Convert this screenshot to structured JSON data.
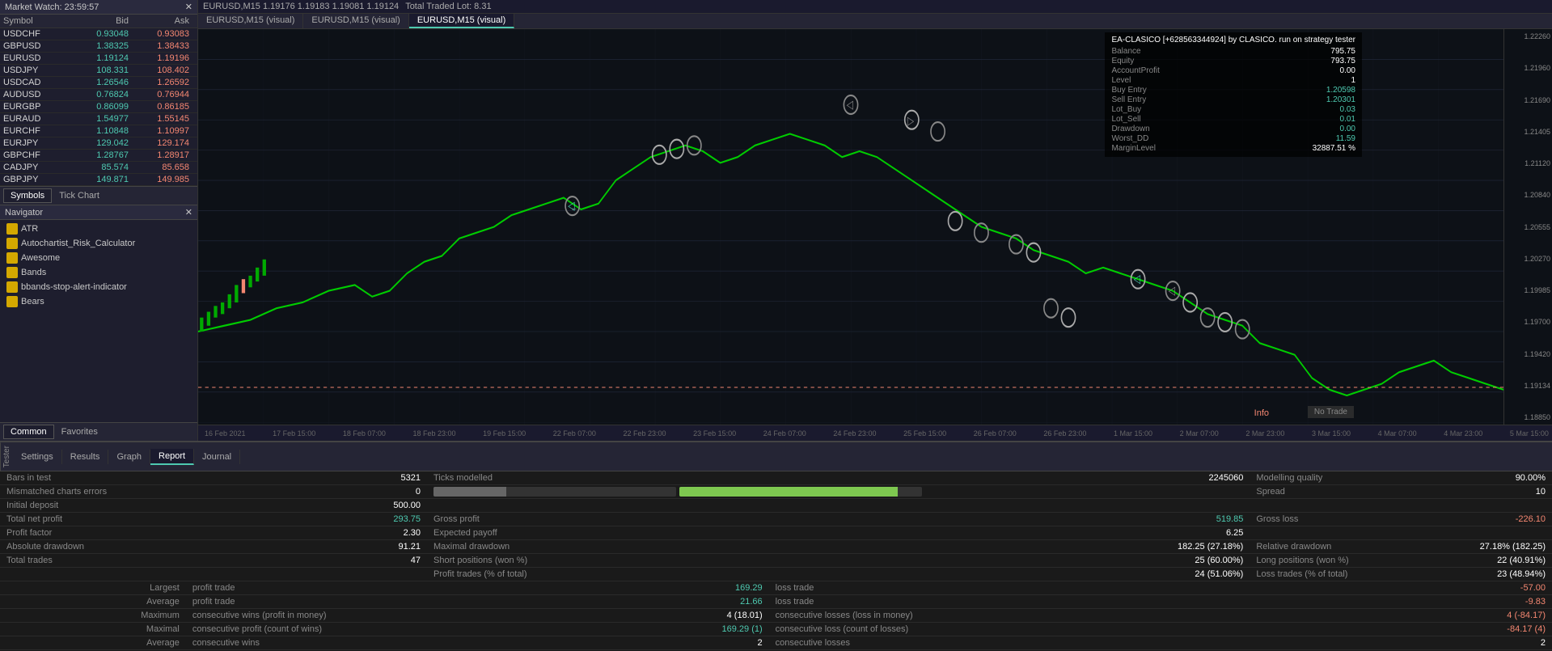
{
  "market_watch": {
    "title": "Market Watch: 23:59:57",
    "columns": [
      "Symbol",
      "Bid",
      "Ask"
    ],
    "rows": [
      {
        "symbol": "USDCHF",
        "bid": "0.93048",
        "ask": "0.93083"
      },
      {
        "symbol": "GBPUSD",
        "bid": "1.38325",
        "ask": "1.38433"
      },
      {
        "symbol": "EURUSD",
        "bid": "1.19124",
        "ask": "1.19196"
      },
      {
        "symbol": "USDJPY",
        "bid": "108.331",
        "ask": "108.402"
      },
      {
        "symbol": "USDCAD",
        "bid": "1.26546",
        "ask": "1.26592"
      },
      {
        "symbol": "AUDUSD",
        "bid": "0.76824",
        "ask": "0.76944"
      },
      {
        "symbol": "EURGBP",
        "bid": "0.86099",
        "ask": "0.86185"
      },
      {
        "symbol": "EURAUD",
        "bid": "1.54977",
        "ask": "1.55145"
      },
      {
        "symbol": "EURCHF",
        "bid": "1.10848",
        "ask": "1.10997"
      },
      {
        "symbol": "EURJPY",
        "bid": "129.042",
        "ask": "129.174"
      },
      {
        "symbol": "GBPCHF",
        "bid": "1.28767",
        "ask": "1.28917"
      },
      {
        "symbol": "CADJPY",
        "bid": "85.574",
        "ask": "85.658"
      },
      {
        "symbol": "GBPJPY",
        "bid": "149.871",
        "ask": "149.985"
      }
    ],
    "tabs": [
      "Symbols",
      "Tick Chart"
    ]
  },
  "navigator": {
    "title": "Navigator",
    "items": [
      "ATR",
      "Autochartist_Risk_Calculator",
      "Awesome",
      "Bands",
      "bbands-stop-alert-indicator",
      "Bears"
    ],
    "tabs": [
      "Common",
      "Favorites"
    ]
  },
  "chart": {
    "header_text": "EURUSD,M15 1.19176 1.19183 1.19081 1.19124",
    "traded_lot": "Total Traded Lot: 8.31",
    "tabs": [
      "EURUSD,M15 (visual)",
      "EURUSD,M15 (visual)",
      "EURUSD,M15 (visual)"
    ],
    "active_tab": 2,
    "time_labels": [
      "16 Feb 2021",
      "17 Feb 15:00",
      "18 Feb 07:00",
      "18 Feb 23:00",
      "19 Feb 15:00",
      "22 Feb 07:00",
      "22 Feb 23:00",
      "23 Feb 15:00",
      "24 Feb 07:00",
      "24 Feb 23:00",
      "25 Feb 15:00",
      "26 Feb 07:00",
      "26 Feb 23:00",
      "1 Mar 15:00",
      "2 Mar 07:00",
      "2 Mar 23:00",
      "3 Mar 15:00",
      "4 Mar 07:00",
      "4 Mar 23:00",
      "5 Mar 15:00"
    ],
    "price_levels": [
      "1.22260",
      "1.21960",
      "1.21690",
      "1.21405",
      "1.21120",
      "1.20840",
      "1.20555",
      "1.20270",
      "1.19985",
      "1.19700",
      "1.19420",
      "1.19134",
      "1.18850"
    ],
    "ea_info": {
      "title": "EA-CLASICO [+628563344924] by CLASICO. run on strategy tester",
      "balance_label": "Balance",
      "balance_value": "795.75",
      "equity_label": "Equity",
      "equity_value": "793.75",
      "account_profit_label": "AccountProfit",
      "account_profit_value": "0.00",
      "level_label": "Level",
      "level_value": "1",
      "buy_entry_label": "Buy Entry",
      "buy_entry_value": "1.20598",
      "sell_entry_label": "Sell Entry",
      "sell_entry_value": "1.20301",
      "lot_buy_label": "Lot_Buy",
      "lot_buy_value": "0.03",
      "lot_sell_label": "Lot_Sell",
      "lot_sell_value": "0.01",
      "drawdown_label": "Drawdown",
      "drawdown_value": "0.00",
      "worst_dd_label": "Worst_DD",
      "worst_dd_value": "11.59",
      "margin_level_label": "MarginLevel",
      "margin_level_value": "32887.51 %"
    },
    "no_trade": "No Trade",
    "info_label": "Info"
  },
  "report": {
    "tabs": [
      "Settings",
      "Results",
      "Graph",
      "Report",
      "Journal"
    ],
    "active_tab": "Report",
    "tester_label": "Tester",
    "rows": {
      "bars_in_test_label": "Bars in test",
      "bars_in_test_value": "5321",
      "ticks_modelled_label": "Ticks modelled",
      "ticks_modelled_value": "2245060",
      "modelling_quality_label": "Modelling quality",
      "modelling_quality_value": "90.00%",
      "mismatched_label": "Mismatched charts errors",
      "mismatched_value": "0",
      "spread_label": "Spread",
      "spread_value": "10",
      "initial_deposit_label": "Initial deposit",
      "initial_deposit_value": "500.00",
      "total_net_profit_label": "Total net profit",
      "total_net_profit_value": "293.75",
      "gross_profit_label": "Gross profit",
      "gross_profit_value": "519.85",
      "gross_loss_label": "Gross loss",
      "gross_loss_value": "-226.10",
      "profit_factor_label": "Profit factor",
      "profit_factor_value": "2.30",
      "expected_payoff_label": "Expected payoff",
      "expected_payoff_value": "6.25",
      "absolute_drawdown_label": "Absolute drawdown",
      "absolute_drawdown_value": "91.21",
      "maximal_drawdown_label": "Maximal drawdown",
      "maximal_drawdown_value": "182.25 (27.18%)",
      "relative_drawdown_label": "Relative drawdown",
      "relative_drawdown_value": "27.18% (182.25)",
      "total_trades_label": "Total trades",
      "total_trades_value": "47",
      "short_positions_label": "Short positions (won %)",
      "short_positions_value": "25 (60.00%)",
      "long_positions_label": "Long positions (won %)",
      "long_positions_value": "22 (40.91%)",
      "profit_trades_pct_label": "Profit trades (% of total)",
      "profit_trades_pct_value": "24 (51.06%)",
      "loss_trades_pct_label": "Loss trades (% of total)",
      "loss_trades_pct_value": "23 (48.94%)",
      "largest_profit_label": "Largest",
      "largest_profit_col": "profit trade",
      "largest_profit_value": "169.29",
      "largest_loss_label": "loss trade",
      "largest_loss_value": "-57.00",
      "average_profit_label": "Average",
      "average_profit_col": "profit trade",
      "average_profit_value": "21.66",
      "average_loss_label": "loss trade",
      "average_loss_value": "-9.83",
      "maximum_cons_wins_label": "Maximum",
      "maximum_cons_wins_col": "consecutive wins (profit in money)",
      "maximum_cons_wins_value": "4 (18.01)",
      "maximum_cons_losses_label": "consecutive losses (loss in money)",
      "maximum_cons_losses_value": "4 (-84.17)",
      "maximal_cons_profit_label": "Maximal",
      "maximal_cons_profit_col": "consecutive profit (count of wins)",
      "maximal_cons_profit_value": "169.29 (1)",
      "maximal_cons_loss_label": "consecutive loss (count of losses)",
      "maximal_cons_loss_value": "-84.17 (4)",
      "average_cons_wins_label": "Average",
      "average_cons_wins_col": "consecutive wins",
      "average_cons_wins_value": "2",
      "average_cons_losses_label": "consecutive losses",
      "average_cons_losses_value": "2"
    }
  }
}
